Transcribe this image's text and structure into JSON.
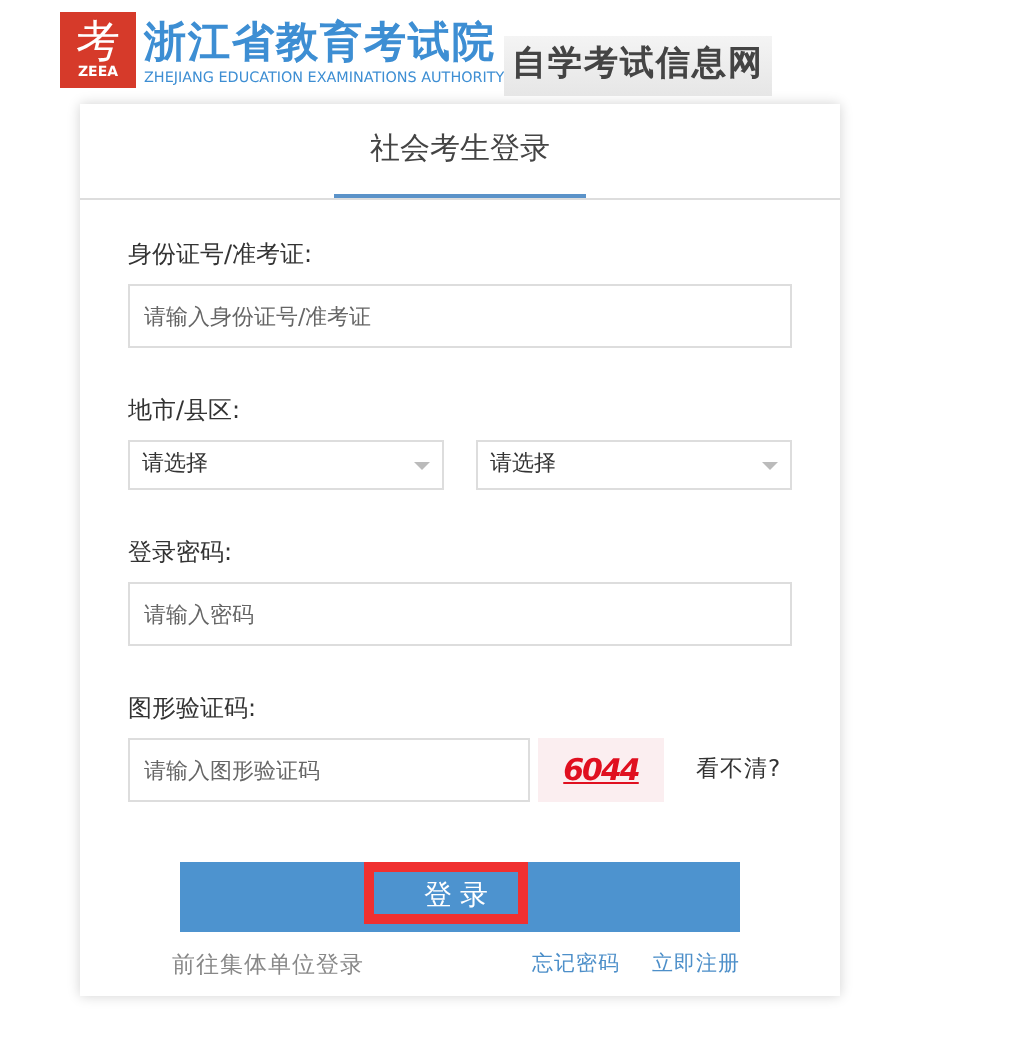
{
  "header": {
    "logo_mark": "考",
    "logo_abbr": "ZEEA",
    "title": "浙江省教育考试院",
    "subtitle": "ZHEJIANG EDUCATION EXAMINATIONS AUTHORITY",
    "site_name": "自学考试信息网"
  },
  "tabs": [
    {
      "label": "社会考生登录",
      "selected": true
    }
  ],
  "fields": [
    {
      "kind": "input",
      "label": "身份证号/准考证:",
      "placeholder": "请输入身份证号/准考证"
    },
    {
      "kind": "selects",
      "label": "地市/县区:",
      "options": [
        "请选择",
        "请选择"
      ]
    },
    {
      "kind": "input",
      "label": "登录密码:",
      "placeholder": "请输入密码"
    },
    {
      "kind": "captcha",
      "label": "图形验证码:",
      "placeholder": "请输入图形验证码",
      "code": "6044",
      "refresh": "看不清?"
    }
  ],
  "login_button": {
    "label": "登录",
    "highlighted": true
  },
  "links": {
    "group_login": "前往集体单位登录",
    "forgot": "忘记密码",
    "register": "立即注册"
  }
}
